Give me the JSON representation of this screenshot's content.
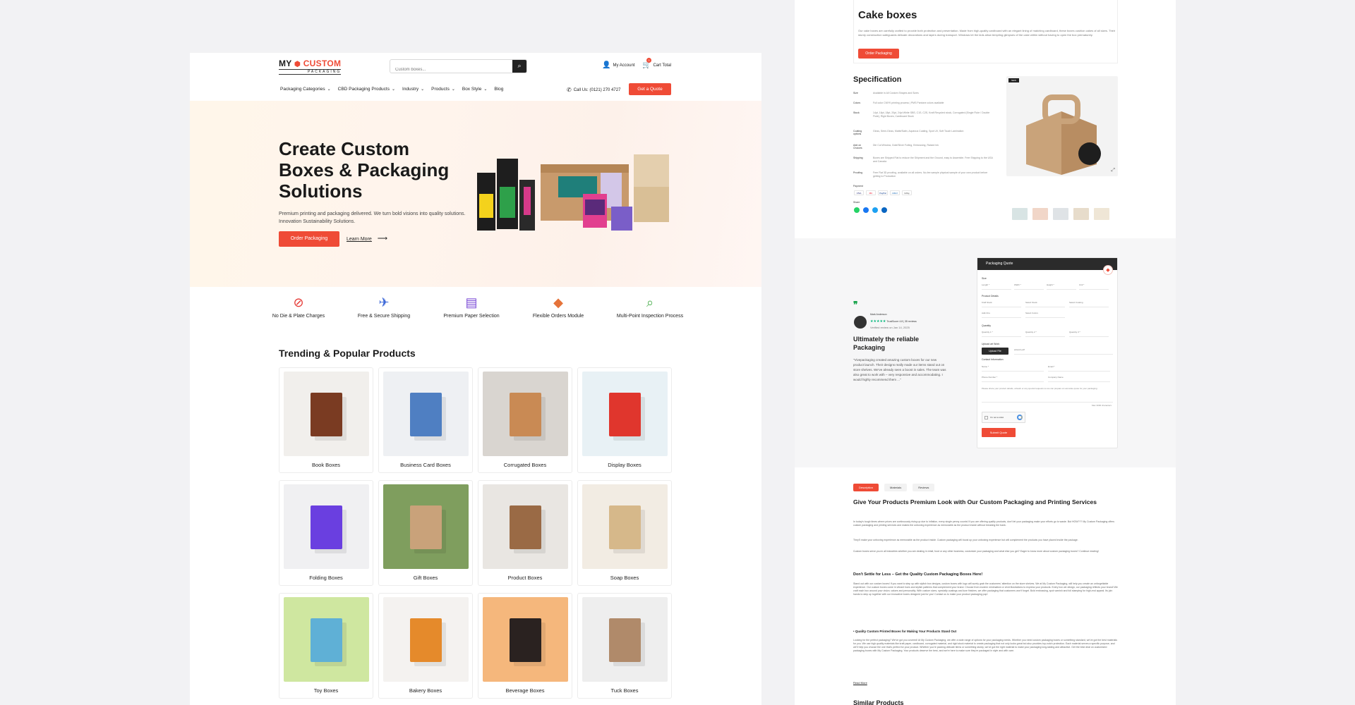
{
  "left": {
    "header": {
      "logo_main": "MY",
      "logo_accent": "CUSTOM",
      "logo_sub": "PACKAGING",
      "search_placeholder": "Custom boxes...",
      "my_account": "My Account",
      "cart": "Cart Total",
      "cart_count": "0",
      "nav": [
        "Packaging Categories",
        "CBD Packaging Products",
        "Industry",
        "Products",
        "Box Style",
        "Blog"
      ],
      "nav_has_dropdown": [
        true,
        true,
        true,
        true,
        true,
        false
      ],
      "call": "Call Us: (0121) 270 4727",
      "quote_button": "Get a Quote"
    },
    "hero": {
      "title": "Create Custom Boxes  & Packaging Solutions",
      "text": "Premium printing and packaging delivered. We turn bold visions into quality solutions. Innovation Sustainability Solutions.",
      "order_button": "Order Packaging",
      "learn_more": "Learn More"
    },
    "features": [
      {
        "label": "No Die & Plate Charges",
        "icon": "no-sign-icon",
        "color": "#e53935"
      },
      {
        "label": "Free & Secure Shipping",
        "icon": "plane-icon",
        "color": "#3f6ad8"
      },
      {
        "label": "Premium Paper Selection",
        "icon": "paper-icon",
        "color": "#7b4bd6"
      },
      {
        "label": "Flexible Orders Module",
        "icon": "box-icon",
        "color": "#e5733a"
      },
      {
        "label": "Multi-Point Inspection Process",
        "icon": "magnifier-icon",
        "color": "#53b356"
      }
    ],
    "trending_title": "Trending & Popular Products",
    "products": [
      {
        "name": "Book Boxes",
        "bg": "#f1efec",
        "fg": "#7a3b22"
      },
      {
        "name": "Business Card Boxes",
        "bg": "#eef0f3",
        "fg": "#4f7fc2"
      },
      {
        "name": "Corrugated Boxes",
        "bg": "#d9d5d0",
        "fg": "#c98a54"
      },
      {
        "name": "Display Boxes",
        "bg": "#e8f1f5",
        "fg": "#e0362d"
      },
      {
        "name": "Folding Boxes",
        "bg": "#f0f0f2",
        "fg": "#6a3fe0"
      },
      {
        "name": "Gift Boxes",
        "bg": "#7f9e5e",
        "fg": "#c9a27a"
      },
      {
        "name": "Product Boxes",
        "bg": "#e9e6e2",
        "fg": "#9a6a45"
      },
      {
        "name": "Soap Boxes",
        "bg": "#f2ece3",
        "fg": "#d6b88a"
      },
      {
        "name": "Toy Boxes",
        "bg": "#cfe7a0",
        "fg": "#5fb0d6"
      },
      {
        "name": "Bakery Boxes",
        "bg": "#f4f2f0",
        "fg": "#e58a2b"
      },
      {
        "name": "Beverage Boxes",
        "bg": "#f5b77c",
        "fg": "#2a2220"
      },
      {
        "name": "Tuck Boxes",
        "bg": "#eeeeee",
        "fg": "#b08a6a"
      }
    ]
  },
  "right": {
    "product_title": "Cake boxes",
    "product_desc": "Our cake boxes are carefully crafted to provide both protection and presentation. Made from high-quality cardboard with an elegant lining of matching cardboard, these boxes cushion cakes of all sizes. Their sturdy construction safeguards delicate decorations and layers during transport. Windows let the kids allow tempting glimpses of the cake within without having to open the box prematurely.",
    "order_button": "Order Packaging",
    "spec_title": "Specification",
    "specs": [
      {
        "k": "Size",
        "v": "Available in All Custom Shapes and Sizes"
      },
      {
        "k": "Colors",
        "v": "Full color CMYK printing process | PMS Pantone colors available"
      },
      {
        "k": "Stock",
        "v": "14pt, 16pt, 18pt, 20pt, 24pt White SBS, C1S, C2S, Kraft Recycled stock, Corrugated (Single Flute / Double Flute), Rigid Boxes, Cardboard Stock"
      },
      {
        "k": "Coating options",
        "v": "Gloss, Semi-Gloss, Matte/Satin, Aqueous Coating, Spot UV, Soft Touch Lamination"
      },
      {
        "k": "Add on Choices",
        "v": "Die Cut Window, Gold/Silver Foiling, Embossing, Raised Ink"
      },
      {
        "k": "Shipping",
        "v": "Boxes are Shipped Flat to reduce the Shipment and the Ground, easy to Assemble. Free Shipping to the USA and Canada"
      },
      {
        "k": "Proofing",
        "v": "Free Flat 3D proofing, available on all orders. No-fee sample physical sample of your own product before getting to Production"
      }
    ],
    "payment_label": "Payment",
    "payment": [
      "VISA",
      "MC",
      "PayPal",
      "AMEX",
      "GPay"
    ],
    "share_label": "Share",
    "main_image_badge": "NEW",
    "review": {
      "name": "Mark Anderson",
      "trust": "TrustScore",
      "rating": "4.8",
      "reviews": "35 reviews",
      "date": "Verified review on Jan 14, 2025",
      "title": "Ultimately the reliable Packaging",
      "body": "\"Vivepackaging created amazing custom boxes for our new product launch. Their designs really made our items stand out on store shelves. We've already seen a boost in sales. The team was also great to work with – very responsive and accommodating. I would highly recommend them ...\""
    },
    "form": {
      "title": "Packaging Quote",
      "size_label": "Size",
      "size_fields": [
        "Length *",
        "Width *",
        "Height *",
        "Unit *"
      ],
      "details_label": "Product Details",
      "detail_selects": [
        "Kraft Stock",
        "Select Stock",
        "Select Coating",
        "Add-Ons",
        "Select Colors"
      ],
      "quantity_label": "Quantity",
      "quantity_fields": [
        "Quantity 1 *",
        "Quantity 2 *",
        "Quantity 3 *"
      ],
      "upload_label": "Upload art Work",
      "upload_button": "Upload File",
      "upload_file": "artwork.pdf",
      "contact_label": "Contact Information",
      "contact_fields": [
        "Name *",
        "Email *",
        "Phone Number *",
        "Company Name"
      ],
      "message_placeholder": "Please share your product details, artwork or any special requests so we can prepare an accurate quote for your packaging.",
      "max_note": "Max 3000 characters",
      "captcha": "I'm not a robot",
      "submit": "Submit Quote"
    },
    "tabs": [
      "Description",
      "Materials",
      "Reviews"
    ],
    "desc_title": "Give Your Products Premium Look with Our Custom Packaging and Printing Services",
    "desc_p1": "In today's tough times where prices are continuously rising up due to inflation, every single penny counts! If you are offering quality products, don't let your packaging make your efforts go to waste. But HOW??? My Custom Packaging offers custom packaging and printing services and makes the unboxing experience as memorable as the product inside without breaking the bank.",
    "desc_p2": "They'll make your unboxing experience as memorable as the product inside. Custom packaging will boost up your unboxing experience but will complement the products you have placed inside the package.",
    "desc_p3": "Custom boxes serve you in all industries whether you are dealing in retail, food or any other business, customize your packaging and what else you get? Eager to know more about custom packaging boxes? Continue reading!",
    "h2": "Don't Settle for Less – Get the Quality Custom Packaging Boxes Here!",
    "desc_p4": "Stand out with our custom boxes! If you want to step up with stylish box designs, custom boxes with logo will surely grab the customers' attention on the store shelves. We at My Custom Packaging, will help you create an unforgettable experience. Our custom boxes come in vibrant hues and stylish patterns that complement your brand. Choose from modern minimalism or vivid illustrations to express your products. Every box we design, our packaging reflects your brand! We craft each box around your vision, values and personality. With custom sizes, specialty coatings and luxe finishes, we offer packaging that customers won't forget. Bold embossing, spot varnish and foil stamping for high-end appeal. Its join hands to step up together with our innovative boxes designed just for you! Contact us to make your product packaging pop!",
    "h3": "Quality Custom Printed Boxes for Making Your Products Stand Out",
    "desc_p5": "Looking for the perfect packaging? We've got you covered! At My Custom Packaging, we offer a wide range of options for your packaging needs. Whether you need custom packaging boxes or something standard, we've got the best materials for you. We use high-quality materials like kraft paper, cardboard, corrugated material, and rigid stock material to create packaging that not only looks great but also provides top-notch protection. Each material serves a specific purpose, and we'll help you choose the one that's perfect for your product. Whether you're packing delicate items or something sturdy, we've got the right material to make your packaging long-lasting and attractive. Get the best deal on customized packaging boxes with My Custom Packaging. Your products deserve the best, and we're here to make sure they're packaged in style and with care.",
    "read_more": "Read More",
    "similar": "Similar Products"
  }
}
